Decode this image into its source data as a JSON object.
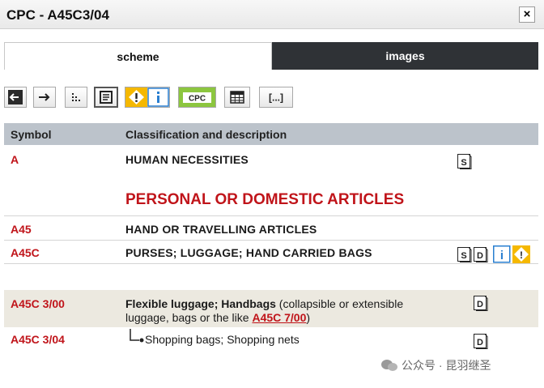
{
  "window": {
    "title": "CPC - A45C3/04",
    "close_label": "×"
  },
  "tabs": [
    {
      "label": "scheme",
      "active": true
    },
    {
      "label": "images",
      "active": false
    }
  ],
  "toolbar": {
    "items": [
      "previous-icon",
      "next-icon",
      "hierarchy-icon",
      "compact-view-icon",
      "warning-icon",
      "info-icon",
      "cpc-icon",
      "table-icon",
      "ellipsis-icon"
    ],
    "cpc_label": "CPC",
    "ellipsis_label": "[...]"
  },
  "table": {
    "header": {
      "symbol": "Symbol",
      "description": "Classification and description"
    },
    "rows": [
      {
        "symbol": "A",
        "description": "HUMAN NECESSITIES"
      },
      {
        "heading": "PERSONAL OR DOMESTIC ARTICLES"
      },
      {
        "symbol": "A45",
        "description": "HAND OR TRAVELLING ARTICLES"
      },
      {
        "symbol": "A45C",
        "description": "PURSES; LUGGAGE; HAND CARRIED BAGS"
      },
      {
        "symbol": "A45C 3/00",
        "description_bold": "Flexible luggage; Handbags",
        "description_rest_1": " (collapsible or extensible",
        "description_rest_2": "luggage, bags or the like ",
        "link": "A45C 7/00",
        "description_close": ")"
      },
      {
        "symbol": "A45C 3/04",
        "description": "Shopping bags; Shopping nets"
      }
    ]
  },
  "icons": {
    "s_label": "S",
    "d_label": "D",
    "i_label": "i",
    "warn_label": "!"
  },
  "watermark": "公众号 · 昆羽继圣",
  "colors": {
    "accent_red": "#c0141a",
    "header_bg": "#bcc3cb",
    "highlight_bg": "#ece9e0",
    "dark_tab": "#2f3236",
    "warn_yellow": "#f5b800",
    "info_blue": "#2a7fd0",
    "cpc_green": "#8cc63f"
  }
}
